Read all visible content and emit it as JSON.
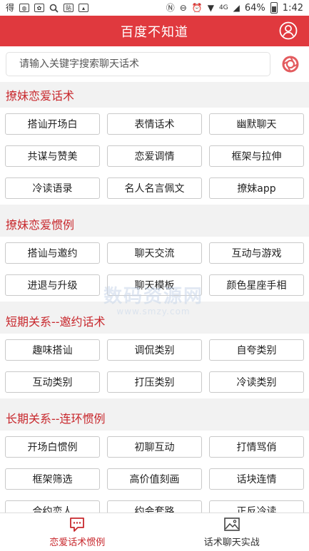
{
  "status_bar": {
    "left_icons": [
      "weibo-icon",
      "baidu-icon",
      "baidu-paw-icon",
      "search-icon",
      "tieba-icon",
      "image-icon"
    ],
    "battery": "64%",
    "time": "1:42",
    "signal_label": "4G"
  },
  "header": {
    "title": "百度不知道",
    "user_icon": "user-icon"
  },
  "search": {
    "placeholder": "请输入关键字搜索聊天话术",
    "camera_icon": "camera-icon"
  },
  "sections": [
    {
      "title": "撩妹恋爱话术",
      "items": [
        "搭讪开场白",
        "表情话术",
        "幽默聊天",
        "共谋与赞美",
        "恋爱调情",
        "框架与拉伸",
        "冷读语录",
        "名人名言佩文",
        "撩妹app"
      ]
    },
    {
      "title": "撩妹恋爱惯例",
      "items": [
        "搭讪与邀约",
        "聊天交流",
        "互动与游戏",
        "进退与升级",
        "聊天模板",
        "颜色星座手相"
      ]
    },
    {
      "title": "短期关系--邀约话术",
      "items": [
        "趣味搭讪",
        "调侃类别",
        "自夸类别",
        "互动类别",
        "打压类别",
        "冷读类别"
      ]
    },
    {
      "title": "长期关系--连环惯例",
      "items": [
        "开场白惯例",
        "初聊互动",
        "打情骂俏",
        "框架筛选",
        "高价值刻画",
        "话块连情",
        "合约恋人",
        "约会套路",
        "正反冷读"
      ]
    }
  ],
  "tabs": [
    {
      "label": "恋爱话术惯例",
      "icon": "chat-bubble-icon",
      "active": true
    },
    {
      "label": "话术聊天实战",
      "icon": "picture-icon",
      "active": false
    }
  ],
  "watermark": {
    "main": "数码资源网",
    "sub": "www.smzy.com"
  },
  "colors": {
    "brand_red": "#e0393e",
    "section_title_red": "#c8282d"
  }
}
